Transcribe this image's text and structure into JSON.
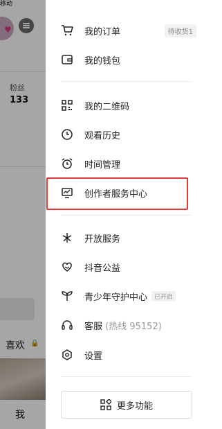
{
  "background": {
    "status_carrier": "移动",
    "fans_label": "粉丝",
    "fans_count": "133",
    "likes_tab": "喜欢",
    "bottom_tab": "我"
  },
  "menu": {
    "orders": {
      "label": "我的订单",
      "badge": "待收货1"
    },
    "wallet": {
      "label": "我的钱包"
    },
    "qrcode": {
      "label": "我的二维码"
    },
    "history": {
      "label": "观看历史"
    },
    "time": {
      "label": "时间管理"
    },
    "creator": {
      "label": "创作者服务中心"
    },
    "open_service": {
      "label": "开放服务"
    },
    "charity": {
      "label": "抖音公益"
    },
    "youth": {
      "label": "青少年守护中心",
      "tag": "已开启"
    },
    "support": {
      "label": "客服",
      "sub": "(热线 95152)"
    },
    "settings": {
      "label": "设置"
    }
  },
  "more_button": {
    "label": "更多功能"
  },
  "colors": {
    "highlight": "#e53935",
    "text": "#222222",
    "muted": "#999999"
  }
}
